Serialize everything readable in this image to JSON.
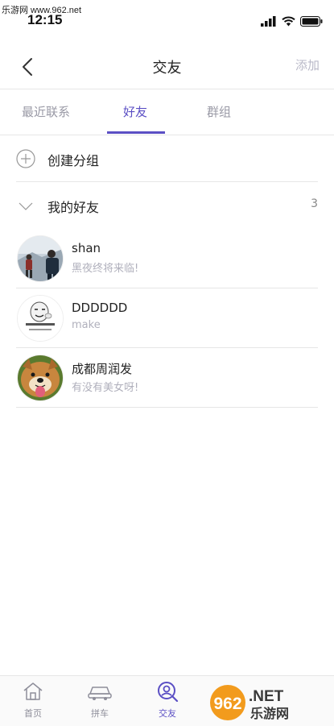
{
  "watermark_top": "乐游网 www.962.net",
  "status_bar": {
    "time": "12:15"
  },
  "nav": {
    "title": "交友",
    "add_label": "添加"
  },
  "tabs": [
    {
      "label": "最近联系",
      "active": false
    },
    {
      "label": "好友",
      "active": true
    },
    {
      "label": "群组",
      "active": false
    }
  ],
  "create_group": {
    "label": "创建分组"
  },
  "my_friends": {
    "label": "我的好友",
    "count": "3"
  },
  "friends": [
    {
      "name": "shan",
      "status": "黑夜终将来临!"
    },
    {
      "name": "DDDDDD",
      "status": "make"
    },
    {
      "name": "成都周润发",
      "status": "有没有美女呀!"
    }
  ],
  "tab_bar": {
    "items": [
      {
        "label": "首页",
        "icon": "home-icon"
      },
      {
        "label": "拼车",
        "icon": "car-icon"
      },
      {
        "label": "交友",
        "icon": "friends-icon",
        "active": true
      }
    ]
  },
  "watermark_logo": {
    "brand": "962",
    "suffix": ".NET",
    "caption": "乐游网"
  },
  "colors": {
    "accent": "#5b4fc4",
    "muted": "#b0b0bc",
    "divider": "#e6e6e6"
  }
}
